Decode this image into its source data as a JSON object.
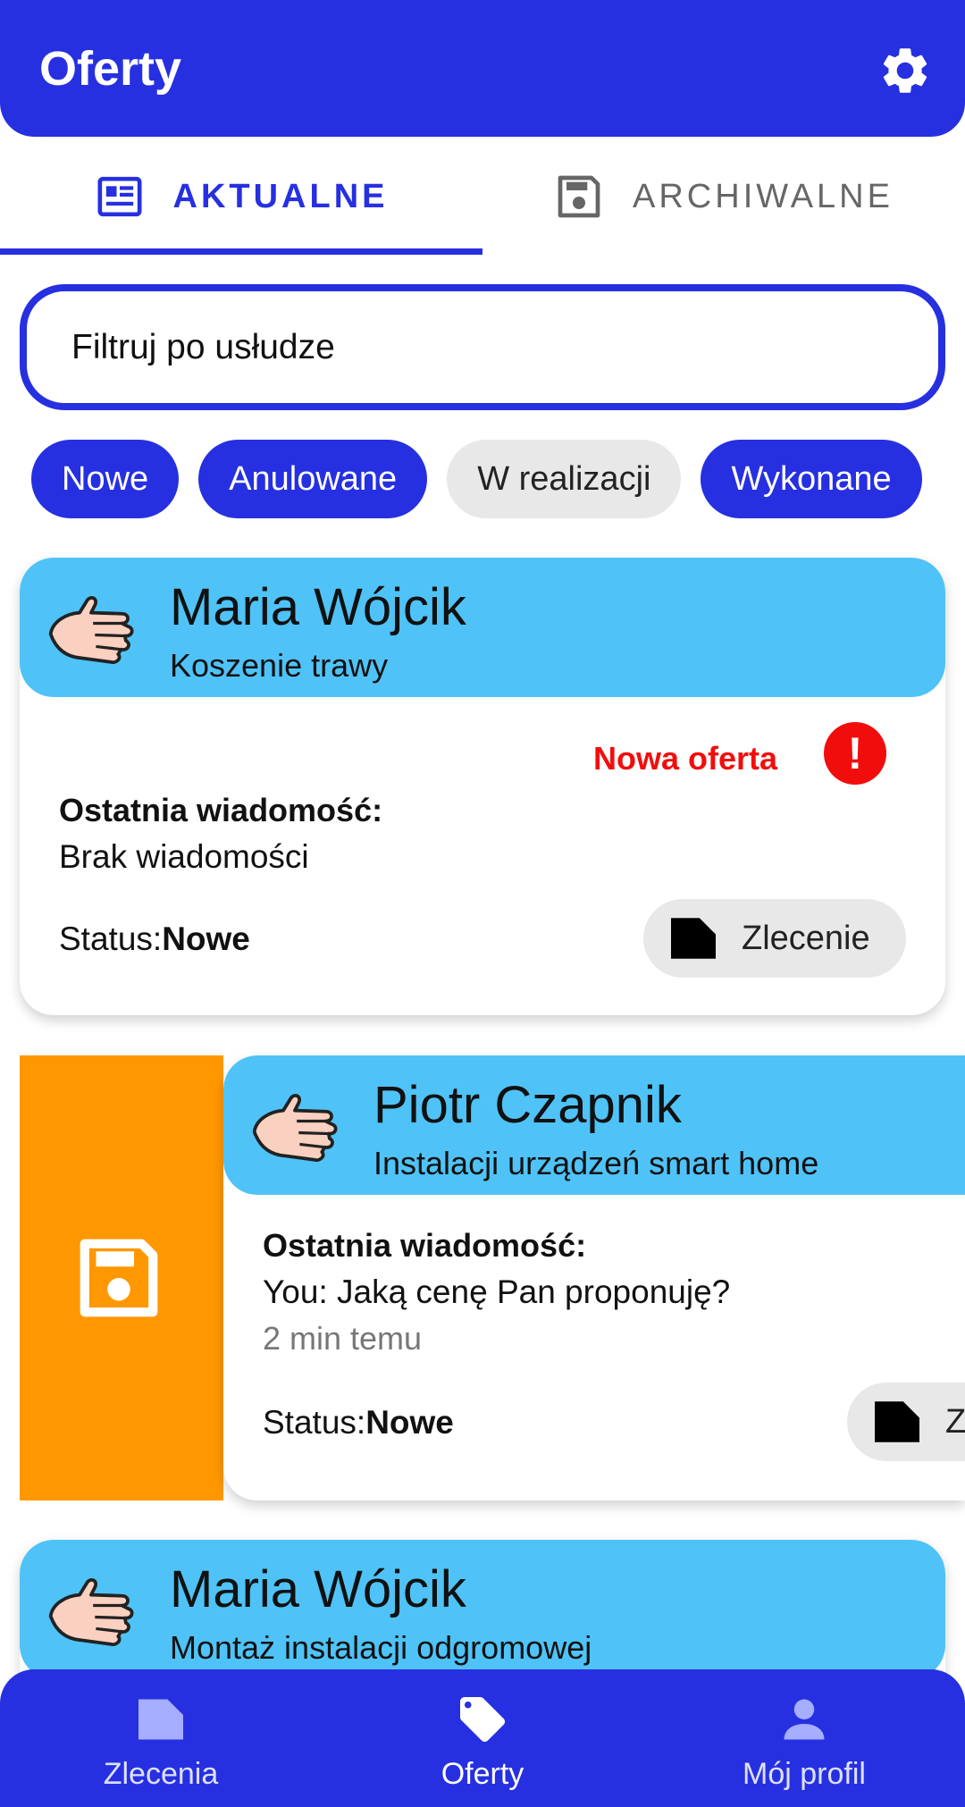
{
  "appbar": {
    "title": "Oferty",
    "settings_icon": "gear-icon"
  },
  "tabs": [
    {
      "label": "AKTUALNE",
      "icon": "newspaper-icon",
      "active": true
    },
    {
      "label": "ARCHIWALNE",
      "icon": "save-icon",
      "active": false
    }
  ],
  "search": {
    "placeholder": "Filtruj po usłudze"
  },
  "filters": [
    {
      "label": "Nowe",
      "selected": true
    },
    {
      "label": "Anulowane",
      "selected": true
    },
    {
      "label": "W realizacji",
      "selected": false
    },
    {
      "label": "Wykonane",
      "selected": true
    }
  ],
  "offers": [
    {
      "name": "Maria Wójcik",
      "service": "Koszenie trawy",
      "badge": "Nowa oferta",
      "alert_symbol": "!",
      "last_message_label": "Ostatnia wiadomość:",
      "last_message": "Brak wiadomości",
      "status_label": "Status:",
      "status": "Nowe",
      "order_button": "Zlecenie"
    },
    {
      "name": "Piotr Czapnik",
      "service": "Instalacji urządzeń smart home",
      "last_message_label": "Ostatnia wiadomość:",
      "last_message": "You: Jaką cenę Pan proponuję?",
      "last_message_time": "2 min temu",
      "status_label": "Status:",
      "status": "Nowe",
      "order_button": "Zlecenie",
      "swipe_action_icon": "save-icon"
    },
    {
      "name": "Maria Wójcik",
      "service": "Montaż instalacji odgromowej"
    }
  ],
  "bottom_nav": [
    {
      "label": "Zlecenia",
      "icon": "document-icon",
      "active": false
    },
    {
      "label": "Oferty",
      "icon": "tag-icon",
      "active": true
    },
    {
      "label": "Mój profil",
      "icon": "person-icon",
      "active": false
    }
  ],
  "colors": {
    "primary": "#2630E0",
    "card_header": "#4FC3F7",
    "swipe_archive": "#FF9800",
    "alert": "#F20D0D"
  }
}
